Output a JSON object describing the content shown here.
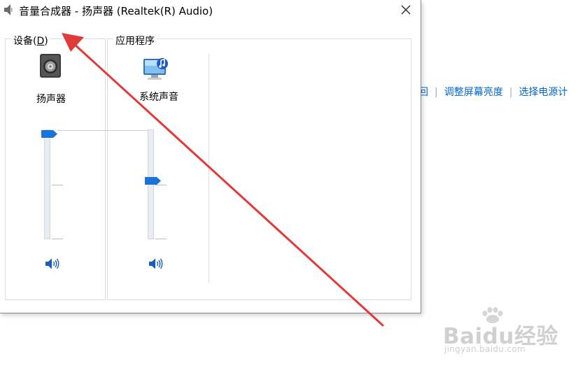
{
  "window": {
    "title": "音量合成器 - 扬声器 (Realtek(R) Audio)",
    "icon": "speaker-icon",
    "close_icon": "close-icon"
  },
  "devices": {
    "label_text": "设备(",
    "label_accesskey": "D",
    "label_close": ")",
    "device": {
      "name": "扬声器",
      "icon": "speaker-device-icon",
      "volume_percent": 100,
      "mute_icon": "speaker-volume-icon"
    }
  },
  "applications": {
    "label": "应用程序",
    "items": [
      {
        "name": "系统声音",
        "icon": "system-sounds-icon",
        "volume_percent": 55,
        "mute_icon": "speaker-volume-icon"
      }
    ]
  },
  "background": {
    "partial_link": "回",
    "links": [
      "调整屏幕亮度",
      "选择电源计"
    ]
  },
  "watermark": {
    "brand": "Baidu经验",
    "url": "jingyan.baidu.com"
  },
  "colors": {
    "accent": "#1a73d9",
    "link": "#0066cc",
    "annotation_arrow": "#e03b3b"
  }
}
